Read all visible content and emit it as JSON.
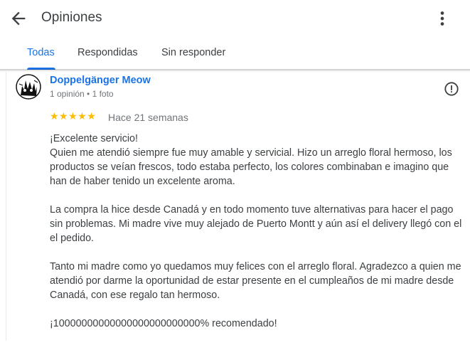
{
  "header": {
    "title": "Opiniones"
  },
  "tabs": [
    {
      "label": "Todas",
      "active": true
    },
    {
      "label": "Respondidas",
      "active": false
    },
    {
      "label": "Sin responder",
      "active": false
    }
  ],
  "review": {
    "author": "Doppelgänger Meow",
    "meta": "1 opinión • 1 foto",
    "stars": "★★★★★",
    "rating": 5,
    "date": "Hace 21 semanas",
    "paragraphs": [
      "¡Excelente servicio!\nQuien me atendió siempre fue muy amable y servicial. Hizo un arreglo floral hermoso, los productos se veían frescos, todo estaba perfecto, los colores combinaban e imagino que han de haber tenido un excelente aroma.",
      "La compra la hice desde Canadá y en todo momento tuve alternativas para hacer el pago sin problemas. Mi madre vive muy alejado de Puerto Montt y aún así el delivery llegó con el el pedido.",
      "Tanto mi madre como yo quedamos muy felices con el arreglo floral. Agradezco a quien me atendió por darme la oportunidad de estar presente en el cumpleaños de mi madre desde Canadá, con ese regalo tan hermoso.",
      "¡10000000000000000000000000% recomendado!"
    ]
  },
  "colors": {
    "accent": "#1a73e8",
    "star": "#fbbc04",
    "secondary_text": "#70757a"
  },
  "icons": {
    "back": "arrow-left-icon",
    "more": "more-vert-icon",
    "report": "report-icon"
  }
}
